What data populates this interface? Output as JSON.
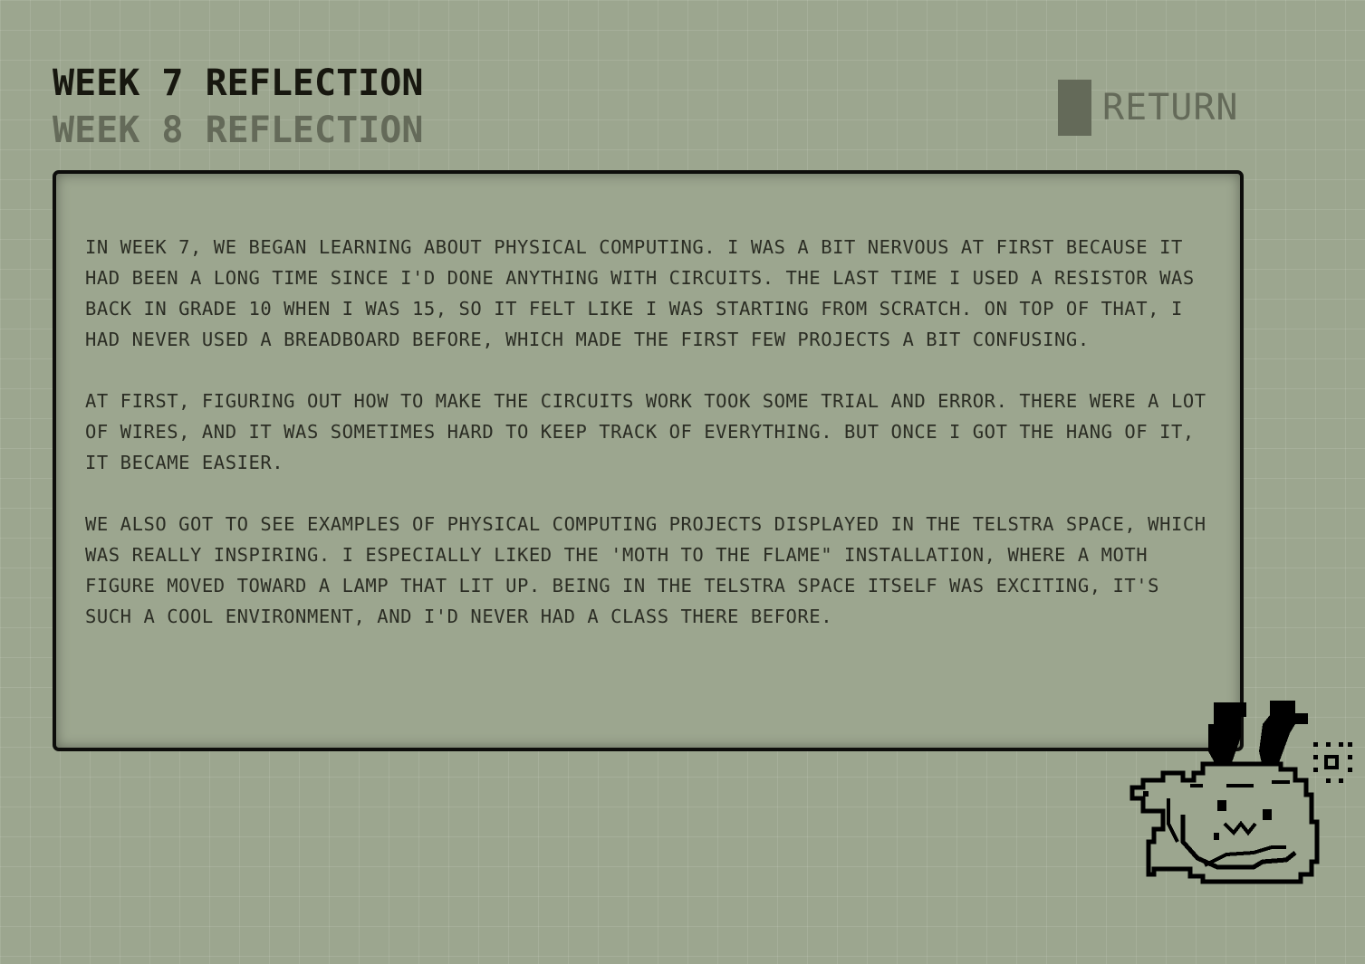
{
  "nav": {
    "items": [
      {
        "label": "Week 7 Reflection",
        "active": true
      },
      {
        "label": "Week 8 Reflection",
        "active": false
      }
    ]
  },
  "return_button": {
    "label": "Return"
  },
  "reflection": {
    "paragraphs": [
      "In week 7, we began learning about physical computing. I was a bit nervous at first because it had been a long time since I'd done anything with circuits. The last time I used a resistor was back in grade 10 when I was 15, so it felt like I was starting from scratch. On top of that, I had never used a breadboard before, which made the first few projects a bit confusing.",
      "At first, figuring out how to make the circuits work took some trial and error. There were a lot of wires, and it was sometimes hard to keep track of everything. But once I got the hang of it, it became easier.",
      "We also got to see examples of physical computing projects displayed in the Telstra Space, which was really inspiring. I especially liked the 'Moth to the Flame\" installation, where a moth figure moved toward a lamp that lit up. Being in the Telstra Space itself was exciting, it's such a cool environment, and I'd never had a class there before."
    ]
  },
  "mascot": {
    "icon": "pixel-bunny-in-bath-icon"
  },
  "colors": {
    "background": "#9ca68f",
    "ink": "#17170f",
    "muted": "#646a59",
    "panel_border": "#0d0d0b"
  }
}
